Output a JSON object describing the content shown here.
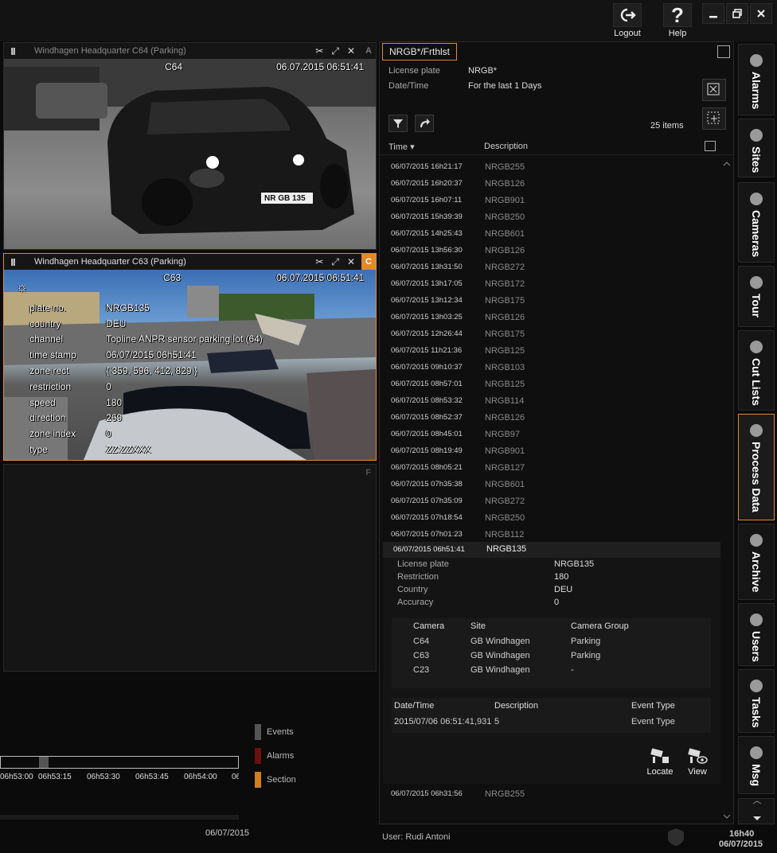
{
  "topbar": {
    "logout_label": "Logout",
    "help_label": "Help"
  },
  "cameras": {
    "a": {
      "title": "Windhagen Headquarter C64 (Parking)",
      "letter": "A",
      "cam_id": "C64",
      "timestamp": "06.07.2015 06:51:41",
      "plate": "NR GB 135"
    },
    "c": {
      "title": "Windhagen Headquarter C63 (Parking)",
      "letter": "C",
      "cam_id": "C63",
      "timestamp": "06.07.2015 06:51:41",
      "meta": [
        {
          "k": "plate no.",
          "v": "NRGB135"
        },
        {
          "k": "country",
          "v": "DEU"
        },
        {
          "k": "channel",
          "v": "Topline ANPR sensor parking lot (64)"
        },
        {
          "k": "time stamp",
          "v": "06/07/2015 06h51:41"
        },
        {
          "k": "zone rect",
          "v": "{ 359, 596, 412, 829 }"
        },
        {
          "k": "restriction",
          "v": "0"
        },
        {
          "k": "speed",
          "v": "180"
        },
        {
          "k": "direction",
          "v": "269"
        },
        {
          "k": "zone index",
          "v": "0"
        },
        {
          "k": "type",
          "v": "ZZ:ZZXXX"
        }
      ]
    },
    "f": {
      "letter": "F"
    }
  },
  "legend": [
    {
      "label": "Events",
      "color": "#555555"
    },
    {
      "label": "Alarms",
      "color": "#6a1010"
    },
    {
      "label": "Section",
      "color": "#d27d1e"
    }
  ],
  "timeline": {
    "ticks": [
      "06h53:00",
      "06h53:15",
      "06h53:30",
      "06h53:45",
      "06h54:00",
      "06"
    ],
    "date": "06/07/2015"
  },
  "process": {
    "tab_label": "NRGB*/Frthlst",
    "filter": [
      {
        "label": "License plate",
        "value": "NRGB*"
      },
      {
        "label": "Date/Time",
        "value": "For the last 1 Days"
      }
    ],
    "item_count": "25 items",
    "col_time": "Time ▾",
    "col_desc": "Description",
    "rows": [
      {
        "time": "06/07/2015 16h21:17",
        "desc": "NRGB255"
      },
      {
        "time": "06/07/2015 16h20:37",
        "desc": "NRGB126"
      },
      {
        "time": "06/07/2015 16h07:11",
        "desc": "NRGB901"
      },
      {
        "time": "06/07/2015 15h39:39",
        "desc": "NRGB250"
      },
      {
        "time": "06/07/2015 14h25:43",
        "desc": "NRGB601"
      },
      {
        "time": "06/07/2015 13h56:30",
        "desc": "NRGB126"
      },
      {
        "time": "06/07/2015 13h31:50",
        "desc": "NRGB272"
      },
      {
        "time": "06/07/2015 13h17:05",
        "desc": "NRGB172"
      },
      {
        "time": "06/07/2015 13h12:34",
        "desc": "NRGB175"
      },
      {
        "time": "06/07/2015 13h03:25",
        "desc": "NRGB126"
      },
      {
        "time": "06/07/2015 12h26:44",
        "desc": "NRGB175"
      },
      {
        "time": "06/07/2015 11h21:36",
        "desc": "NRGB125"
      },
      {
        "time": "06/07/2015 09h10:37",
        "desc": "NRGB103"
      },
      {
        "time": "06/07/2015 08h57:01",
        "desc": "NRGB125"
      },
      {
        "time": "06/07/2015 08h53:32",
        "desc": "NRGB114"
      },
      {
        "time": "06/07/2015 08h52:37",
        "desc": "NRGB126"
      },
      {
        "time": "06/07/2015 08h45:01",
        "desc": "NRGB97"
      },
      {
        "time": "06/07/2015 08h19:49",
        "desc": "NRGB901"
      },
      {
        "time": "06/07/2015 08h05:21",
        "desc": "NRGB127"
      },
      {
        "time": "06/07/2015 07h35:38",
        "desc": "NRGB601"
      },
      {
        "time": "06/07/2015 07h35:09",
        "desc": "NRGB272"
      },
      {
        "time": "06/07/2015 07h18:54",
        "desc": "NRGB250"
      },
      {
        "time": "06/07/2015 07h01:23",
        "desc": "NRGB112"
      }
    ],
    "selected": {
      "time": "06/07/2015 06h51:41",
      "desc": "NRGB135",
      "fields": [
        {
          "label": "License plate",
          "value": "NRGB135"
        },
        {
          "label": "Restriction",
          "value": "180"
        },
        {
          "label": "Country",
          "value": "DEU"
        },
        {
          "label": "Accuracy",
          "value": "0"
        }
      ],
      "cam_headers": [
        "Camera",
        "Site",
        "Camera Group"
      ],
      "cam_rows": [
        [
          "C64",
          "GB Windhagen",
          "Parking"
        ],
        [
          "C63",
          "GB Windhagen",
          "Parking"
        ],
        [
          "C23",
          "GB Windhagen",
          "-"
        ]
      ],
      "event_headers": [
        "Date/Time",
        "Description",
        "Event Type"
      ],
      "event_rows": [
        [
          "2015/07/06 06:51:41,931",
          "5",
          "Event Type"
        ]
      ],
      "locate_label": "Locate",
      "view_label": "View"
    },
    "last_row": {
      "time": "06/07/2015 06h31:56",
      "desc": "NRGB255"
    }
  },
  "sidebar": [
    "Alarms",
    "Sites",
    "Cameras",
    "Tour",
    "Cut Lists",
    "Process Data",
    "Archive",
    "Users",
    "Tasks",
    "Msg"
  ],
  "status": {
    "user": "User: Rudi Antoni",
    "time": "16h40",
    "date": "06/07/2015"
  }
}
